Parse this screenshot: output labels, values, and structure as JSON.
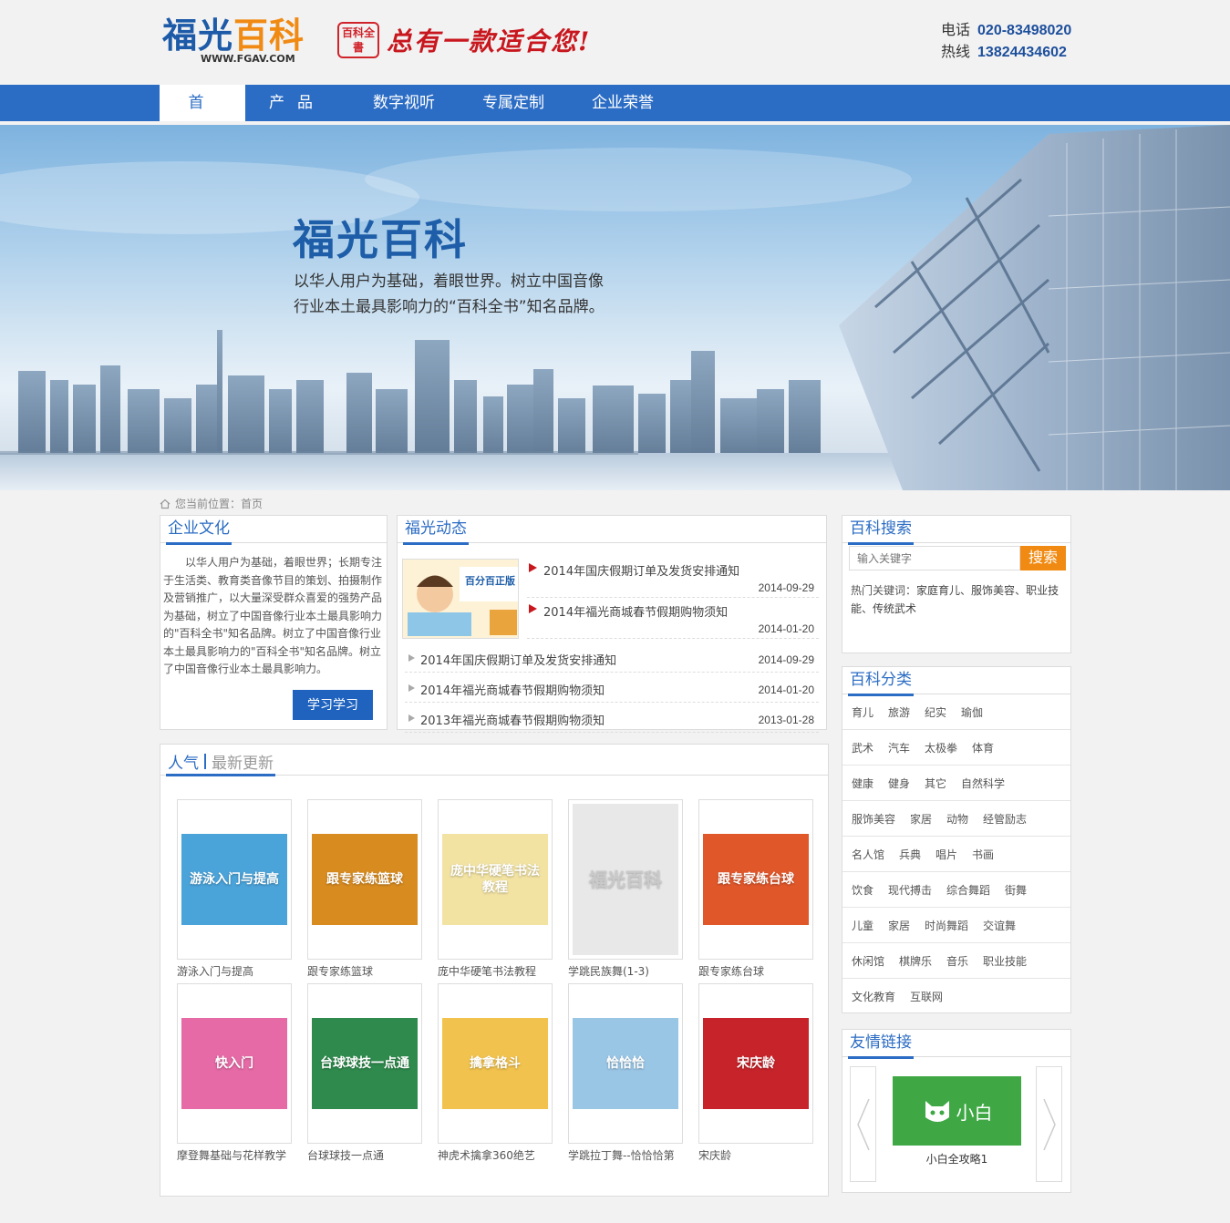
{
  "header": {
    "logo_part1": "福光",
    "logo_part2": "百科",
    "logo_url": "WWW.FGAV.COM",
    "seal_text": "百科全書",
    "slogan": "总有一款适合您!",
    "phone_label": "电话",
    "phone": "020-83498020",
    "hotline_label": "热线",
    "hotline": "13824434602"
  },
  "nav": {
    "items": [
      "首页",
      "产品",
      "数字视听",
      "专属定制",
      "企业荣誉"
    ],
    "active_index": 0
  },
  "banner": {
    "title": "福光百科",
    "text": "以华人用户为基础，着眼世界。树立中国音像行业本土最具影响力的“百科全书”知名品牌。"
  },
  "breadcrumb": {
    "label": "您当前位置：",
    "current": "首页"
  },
  "culture": {
    "title": "企业文化",
    "text": "以华人用户为基础，着眼世界；长期专注于生活类、教育类音像节目的策划、拍摄制作及营销推广，以大量深受群众喜爱的强势产品为基础，树立了中国音像行业本土最具影响力的\"百科全书\"知名品牌。树立了中国音像行业本土最具影响力的\"百科全书\"知名品牌。树立了中国音像行业本土最具影响力。",
    "button": "学习学习"
  },
  "news": {
    "title": "福光动态",
    "image_text": "百分百正版",
    "top_items": [
      {
        "title": "2014年国庆假期订单及发货安排通知",
        "date": "2014-09-29"
      },
      {
        "title": "2014年福光商城春节假期购物须知",
        "date": "2014-01-20"
      }
    ],
    "items": [
      {
        "title": "2014年国庆假期订单及发货安排通知",
        "date": "2014-09-29"
      },
      {
        "title": "2014年福光商城春节假期购物须知",
        "date": "2014-01-20"
      },
      {
        "title": "2013年福光商城春节假期购物须知",
        "date": "2013-01-28"
      }
    ]
  },
  "products": {
    "tab_active": "人气",
    "tab_inactive": "最新更新",
    "items": [
      {
        "name": "游泳入门与提高",
        "cover_text": "游泳入门与提高",
        "color": "#4aa3d9"
      },
      {
        "name": "跟专家练篮球",
        "cover_text": "跟专家练篮球",
        "color": "#d88b1f"
      },
      {
        "name": "庞中华硬笔书法教程",
        "cover_text": "庞中华硬笔书法教程",
        "color": "#f2e3a3"
      },
      {
        "name": "学跳民族舞(1-3)",
        "cover_text": "福光百科",
        "color": "#e8e8e8"
      },
      {
        "name": "跟专家练台球",
        "cover_text": "跟专家练台球",
        "color": "#e0572a"
      },
      {
        "name": "摩登舞基础与花样教学",
        "cover_text": "快入门",
        "color": "#e56aa6"
      },
      {
        "name": "台球球技一点通",
        "cover_text": "台球球技一点通",
        "color": "#2f8a4d"
      },
      {
        "name": "神虎术擒拿360绝艺",
        "cover_text": "擒拿格斗",
        "color": "#f1c24d"
      },
      {
        "name": "学跳拉丁舞--恰恰恰第",
        "cover_text": "恰恰恰",
        "color": "#9ac6e6"
      },
      {
        "name": "宋庆龄",
        "cover_text": "宋庆龄",
        "color": "#c7232a"
      }
    ]
  },
  "search": {
    "title": "百科搜索",
    "placeholder": "输入关键字",
    "button": "搜索",
    "hot_label": "热门关键词：",
    "keywords": [
      "家庭育儿",
      "服饰美容",
      "职业技能",
      "传统武术"
    ]
  },
  "categories": {
    "title": "百科分类",
    "rows": [
      [
        "育儿",
        "旅游",
        "纪实",
        "瑜伽"
      ],
      [
        "武术",
        "汽车",
        "太极拳",
        "体育"
      ],
      [
        "健康",
        "健身",
        "其它",
        "自然科学"
      ],
      [
        "服饰美容",
        "家居",
        "动物",
        "经管励志"
      ],
      [
        "名人馆",
        "兵典",
        "唱片",
        "书画"
      ],
      [
        "饮食",
        "现代搏击",
        "综合舞蹈",
        "街舞"
      ],
      [
        "儿童",
        "家居",
        "时尚舞蹈",
        "交谊舞"
      ],
      [
        "休闲馆",
        "棋牌乐",
        "音乐",
        "职业技能"
      ],
      [
        "文化教育",
        "互联网"
      ]
    ]
  },
  "links": {
    "title": "友情链接",
    "logo_text": "小白",
    "name": "小白全攻略1"
  },
  "colors": {
    "primary": "#2b6cc4",
    "accent": "#f08a12",
    "page_bg": "#f2f2f2"
  }
}
